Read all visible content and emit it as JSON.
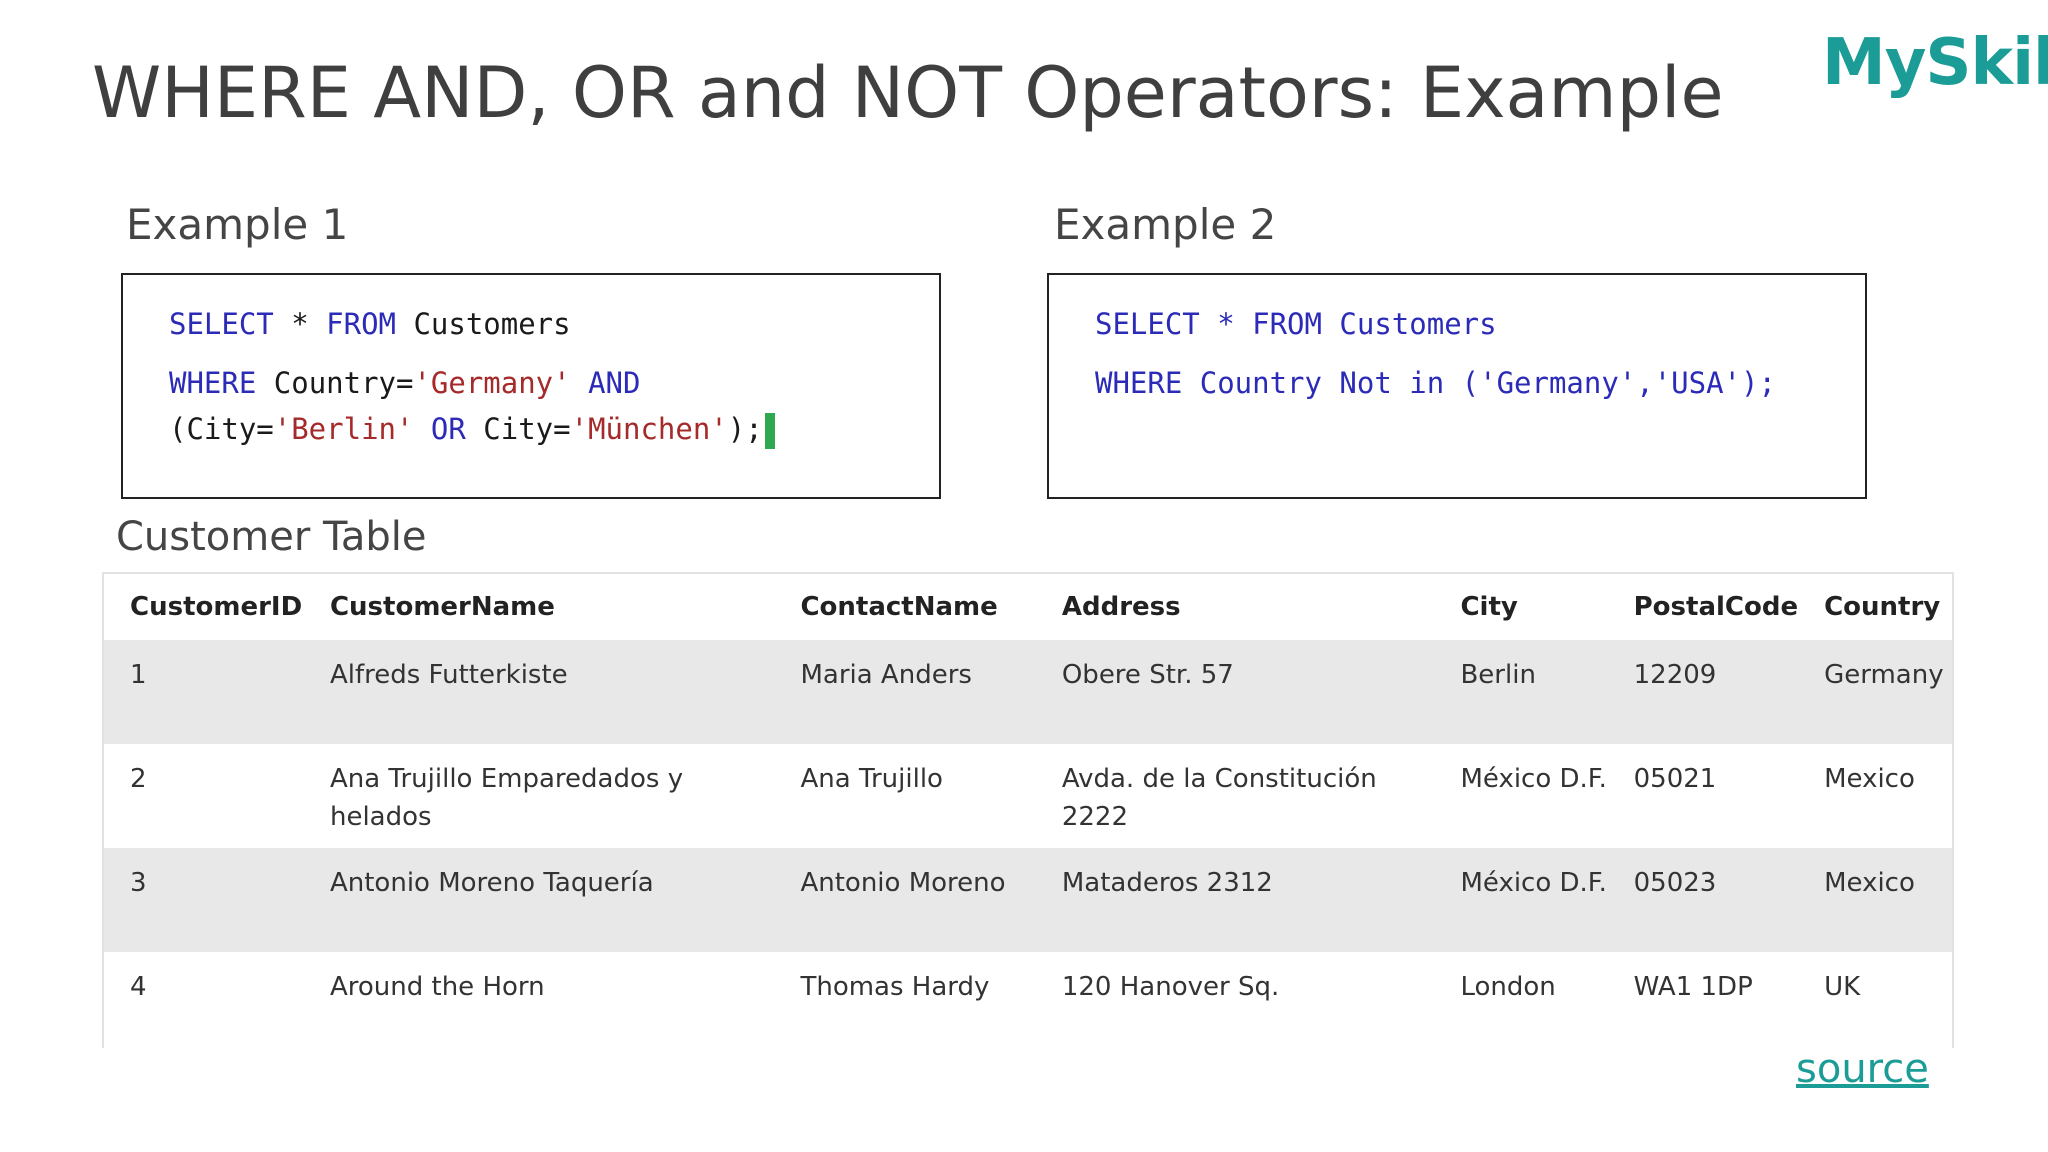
{
  "slide": {
    "title": "WHERE AND, OR and NOT Operators: Example",
    "logo_text": "MySkill",
    "source_link": "source"
  },
  "example1": {
    "label": "Example 1",
    "line1": {
      "kw1": "SELECT",
      "op": " * ",
      "kw2": "FROM",
      "rest": " Customers"
    },
    "line2": {
      "kw1": "WHERE",
      "rest1": " Country=",
      "str1": "'Germany'",
      "sp": " ",
      "kw2": "AND"
    },
    "line3": {
      "p1": "(City=",
      "str1": "'Berlin'",
      "sp1": " ",
      "kw1": "OR",
      "p2": " City=",
      "str2": "'München'",
      "p3": ");"
    }
  },
  "example2": {
    "label": "Example 2",
    "line1": "SELECT * FROM Customers",
    "line2": "WHERE Country Not in ('Germany','USA');"
  },
  "customer_table": {
    "label": "Customer Table",
    "columns": [
      "CustomerID",
      "CustomerName",
      "ContactName",
      "Address",
      "City",
      "PostalCode",
      "Country"
    ],
    "rows": [
      [
        "1",
        "Alfreds Futterkiste",
        "Maria Anders",
        "Obere Str. 57",
        "Berlin",
        "12209",
        "Germany"
      ],
      [
        "2",
        "Ana Trujillo Emparedados y helados",
        "Ana Trujillo",
        "Avda. de la Constitución 2222",
        "México D.F.",
        "05021",
        "Mexico"
      ],
      [
        "3",
        "Antonio Moreno Taquería",
        "Antonio Moreno",
        "Mataderos 2312",
        "México D.F.",
        "05023",
        "Mexico"
      ],
      [
        "4",
        "Around the Horn",
        "Thomas Hardy",
        "120 Hanover Sq.",
        "London",
        "WA1 1DP",
        "UK"
      ]
    ]
  },
  "colors": {
    "title": "#3f3f3f",
    "brand": "#1b9c97",
    "sql_keyword": "#2b2bb8",
    "sql_string": "#a52a2a",
    "cursor": "#2fa84f",
    "row_stripe": "#e8e8e8"
  }
}
